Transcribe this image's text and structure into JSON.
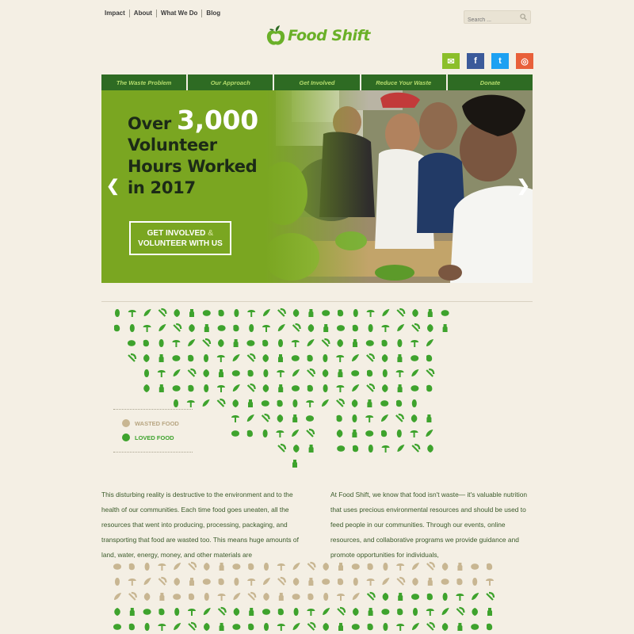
{
  "top_links": [
    "Impact",
    "About",
    "What We Do",
    "Blog"
  ],
  "search": {
    "placeholder": "Search ..."
  },
  "logo": {
    "text": "Food Shift"
  },
  "social": [
    {
      "name": "email",
      "glyph": "✉",
      "color": "#8bbf2a"
    },
    {
      "name": "facebook",
      "glyph": "f",
      "color": "#3b5a9a"
    },
    {
      "name": "twitter",
      "glyph": "t",
      "color": "#1da1f2"
    },
    {
      "name": "instagram",
      "glyph": "◎",
      "color": "#e8603a"
    }
  ],
  "nav": [
    "The Waste Problem",
    "Our Approach",
    "Get Involved",
    "Reduce Your Waste",
    "Donate"
  ],
  "hero": {
    "line1_a": "Over",
    "line1_b": "3,000",
    "line2": "Volunteer",
    "line3": "Hours Worked",
    "line4": "in 2017",
    "cta_a": "GET INVOLVED",
    "cta_amp": "&",
    "cta_b": "VOLUNTEER WITH US"
  },
  "legend": {
    "wasted": "WASTED FOOD",
    "loved": "LOVED FOOD"
  },
  "colors": {
    "loved": "#3ea32d",
    "wasted": "#c8b692",
    "nav_bg": "#2e6b23",
    "hero_bg": "#7aa621"
  },
  "body": {
    "left": "This disturbing reality is destructive to the environment and to the health of our communities. Each time food goes uneaten, all the resources that went into producing, processing, packaging, and transporting that food are wasted too. This means huge amounts of land, water, energy, money, and other materials are",
    "right": "At Food Shift, we know that food isn't waste— it's valuable nutrition that uses precious environmental resources and should be used to feed people in our communities. Through our events, online resources, and collaborative programs we provide guidance and promote opportunities for individuals,"
  }
}
